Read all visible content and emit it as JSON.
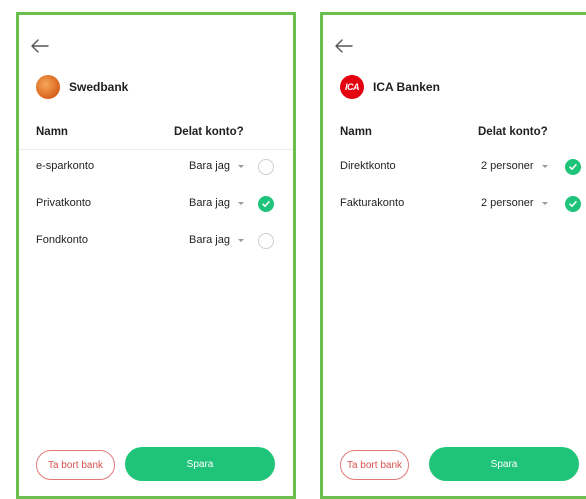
{
  "screens": [
    {
      "bank": {
        "name": "Swedbank",
        "logo": "swedbank-logo"
      },
      "headers": {
        "name": "Namn",
        "shared": "Delat konto?"
      },
      "accounts": [
        {
          "name": "e-sparkonto",
          "shared": "Bara jag",
          "checked": false
        },
        {
          "name": "Privatkonto",
          "shared": "Bara jag",
          "checked": true
        },
        {
          "name": "Fondkonto",
          "shared": "Bara jag",
          "checked": false
        }
      ],
      "remove_label": "Ta bort bank",
      "save_label": "Spara"
    },
    {
      "bank": {
        "name": "ICA Banken",
        "logo_text": "ICA"
      },
      "headers": {
        "name": "Namn",
        "shared": "Delat konto?"
      },
      "accounts": [
        {
          "name": "Direktkonto",
          "shared": "2 personer",
          "checked": true
        },
        {
          "name": "Fakturakonto",
          "shared": "2 personer",
          "checked": true
        }
      ],
      "remove_label": "Ta bort bank",
      "save_label": "Spara"
    }
  ],
  "colors": {
    "frame": "#6bbf4e",
    "accent": "#1fc37a",
    "danger": "#d9534f"
  },
  "icons": {
    "back": "arrow-left-icon",
    "check": "checkmark-icon",
    "dropdown": "caret-down-icon"
  }
}
